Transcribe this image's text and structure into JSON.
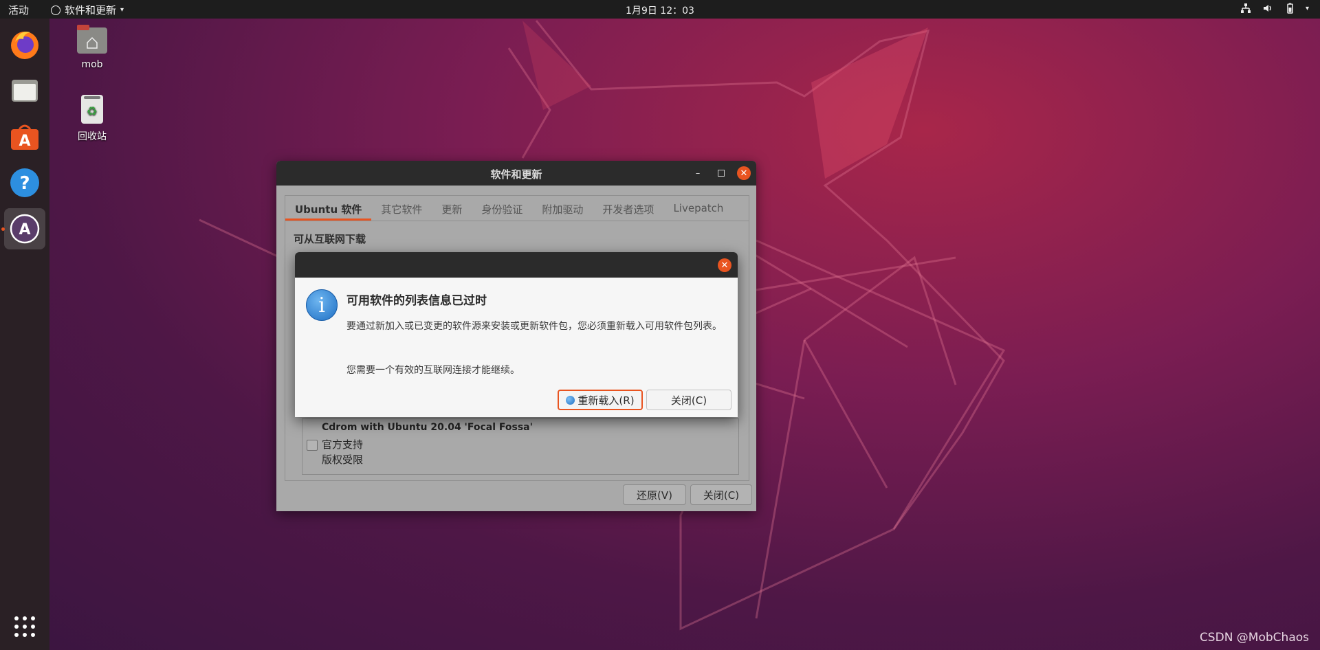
{
  "topbar": {
    "activities": "活动",
    "app_menu": "软件和更新",
    "clock": "1月9日  12：03"
  },
  "desktop": {
    "home_label": "mob",
    "trash_label": "回收站"
  },
  "dock": {
    "items": [
      "firefox-icon",
      "files-icon",
      "software-center-icon",
      "help-icon",
      "software-updater-icon"
    ],
    "show_apps": "show-applications-icon"
  },
  "main_window": {
    "title": "软件和更新",
    "tabs": [
      "Ubuntu 软件",
      "其它软件",
      "更新",
      "身份验证",
      "附加驱动",
      "开发者选项",
      "Livepatch"
    ],
    "active_tab": "Ubuntu 软件",
    "section_title": "可从互联网下载",
    "cdrom": {
      "title": "Cdrom with Ubuntu 20.04 'Focal Fossa'",
      "line2": "官方支持",
      "line3": "版权受限",
      "checked": false
    },
    "revert_button": "还原(V)",
    "close_button": "关闭(C)"
  },
  "dialog": {
    "heading": "可用软件的列表信息已过时",
    "message": "要通过新加入或已变更的软件源来安装或更新软件包，您必须重新载入可用软件包列表。",
    "message2": "您需要一个有效的互联网连接才能继续。",
    "reload_button": "重新载入(R)",
    "close_button": "关闭(C)"
  },
  "watermark": "CSDN @MobChaos",
  "colors": {
    "accent": "#e95420",
    "topbar": "#1d1d1d",
    "dock": "#2a2025",
    "titlebar": "#2b2b2b"
  }
}
